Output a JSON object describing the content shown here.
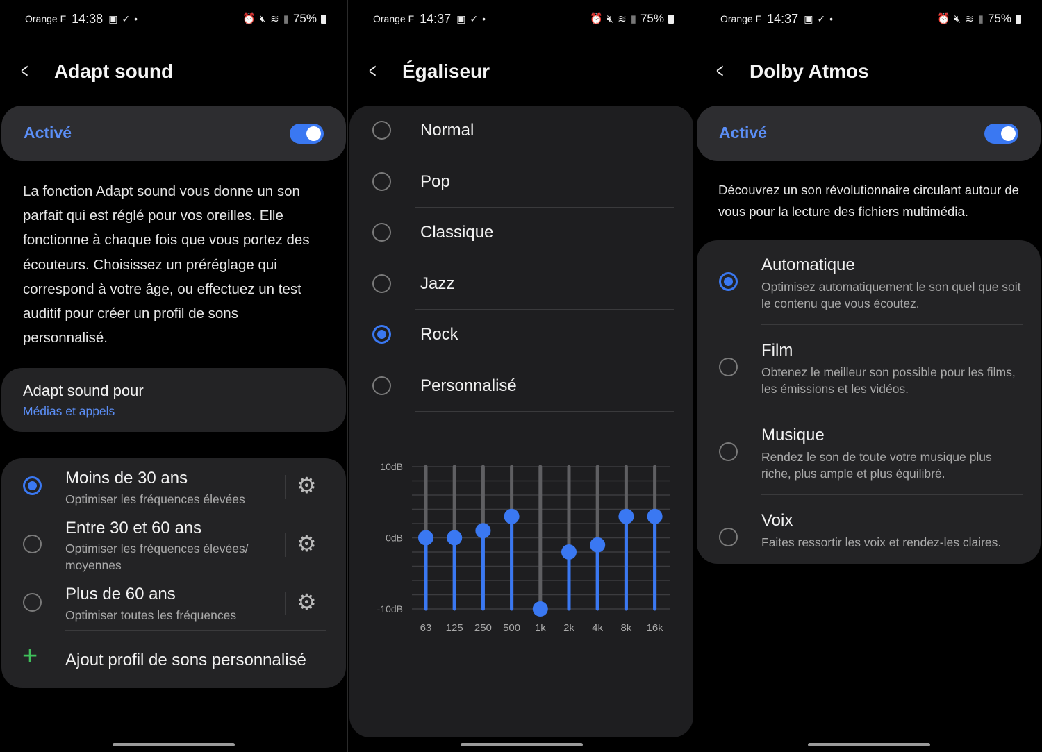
{
  "panels": [
    {
      "status": {
        "carrier": "Orange F",
        "time": "14:38",
        "battery": "75%"
      },
      "title": "Adapt sound"
    },
    {
      "status": {
        "carrier": "Orange F",
        "time": "14:37",
        "battery": "75%"
      },
      "title": "Égaliseur"
    },
    {
      "status": {
        "carrier": "Orange F",
        "time": "14:37",
        "battery": "75%"
      },
      "title": "Dolby Atmos"
    }
  ],
  "adapt": {
    "toggle_label": "Activé",
    "toggle_on": true,
    "description": "La fonction Adapt sound vous donne un son parfait qui est réglé pour vos oreilles. Elle fonctionne à chaque fois que vous portez des écouteurs. Choisissez un préréglage qui correspond à votre âge, ou effectuez un test auditif pour créer un profil de sons personnalisé.",
    "for_label": "Adapt sound pour",
    "for_value": "Médias et appels",
    "profiles": [
      {
        "title": "Moins de 30 ans",
        "sub": "Optimiser les fréquences élevées",
        "selected": true
      },
      {
        "title": "Entre 30 et 60 ans",
        "sub": "Optimiser les fréquences élevées/ moyennes",
        "selected": false
      },
      {
        "title": "Plus de 60 ans",
        "sub": "Optimiser toutes les fréquences",
        "selected": false
      }
    ],
    "add_label": "Ajout profil de sons personnalisé"
  },
  "eq": {
    "presets": [
      {
        "label": "Normal",
        "selected": false
      },
      {
        "label": "Pop",
        "selected": false
      },
      {
        "label": "Classique",
        "selected": false
      },
      {
        "label": "Jazz",
        "selected": false
      },
      {
        "label": "Rock",
        "selected": true
      },
      {
        "label": "Personnalisé",
        "selected": false
      }
    ]
  },
  "chart_data": {
    "type": "bar",
    "categories": [
      "63",
      "125",
      "250",
      "500",
      "1k",
      "2k",
      "4k",
      "8k",
      "16k"
    ],
    "values": [
      0,
      0,
      1,
      3,
      -10,
      -2,
      -1,
      3,
      3
    ],
    "ylim": [
      -10,
      10
    ],
    "y_tick_labels": [
      "10dB",
      "0dB",
      "-10dB"
    ],
    "grid": true,
    "colors": {
      "fill": "#3a78f2",
      "track": "#5f5f62"
    }
  },
  "dolby": {
    "toggle_label": "Activé",
    "toggle_on": true,
    "description": "Découvrez un son révolutionnaire circulant autour de vous pour la lecture des fichiers multimédia.",
    "modes": [
      {
        "title": "Automatique",
        "sub": "Optimisez automatiquement le son quel que soit le contenu que vous écoutez.",
        "selected": true
      },
      {
        "title": "Film",
        "sub": "Obtenez le meilleur son possible pour les films, les émissions et les vidéos.",
        "selected": false
      },
      {
        "title": "Musique",
        "sub": "Rendez le son de toute votre musique plus riche, plus ample et plus équilibré.",
        "selected": false
      },
      {
        "title": "Voix",
        "sub": "Faites ressortir les voix et rendez-les claires.",
        "selected": false
      }
    ]
  },
  "colors": {
    "accent": "#3a78f2",
    "link": "#5b8ef5",
    "add_icon": "#3fbf5a"
  }
}
